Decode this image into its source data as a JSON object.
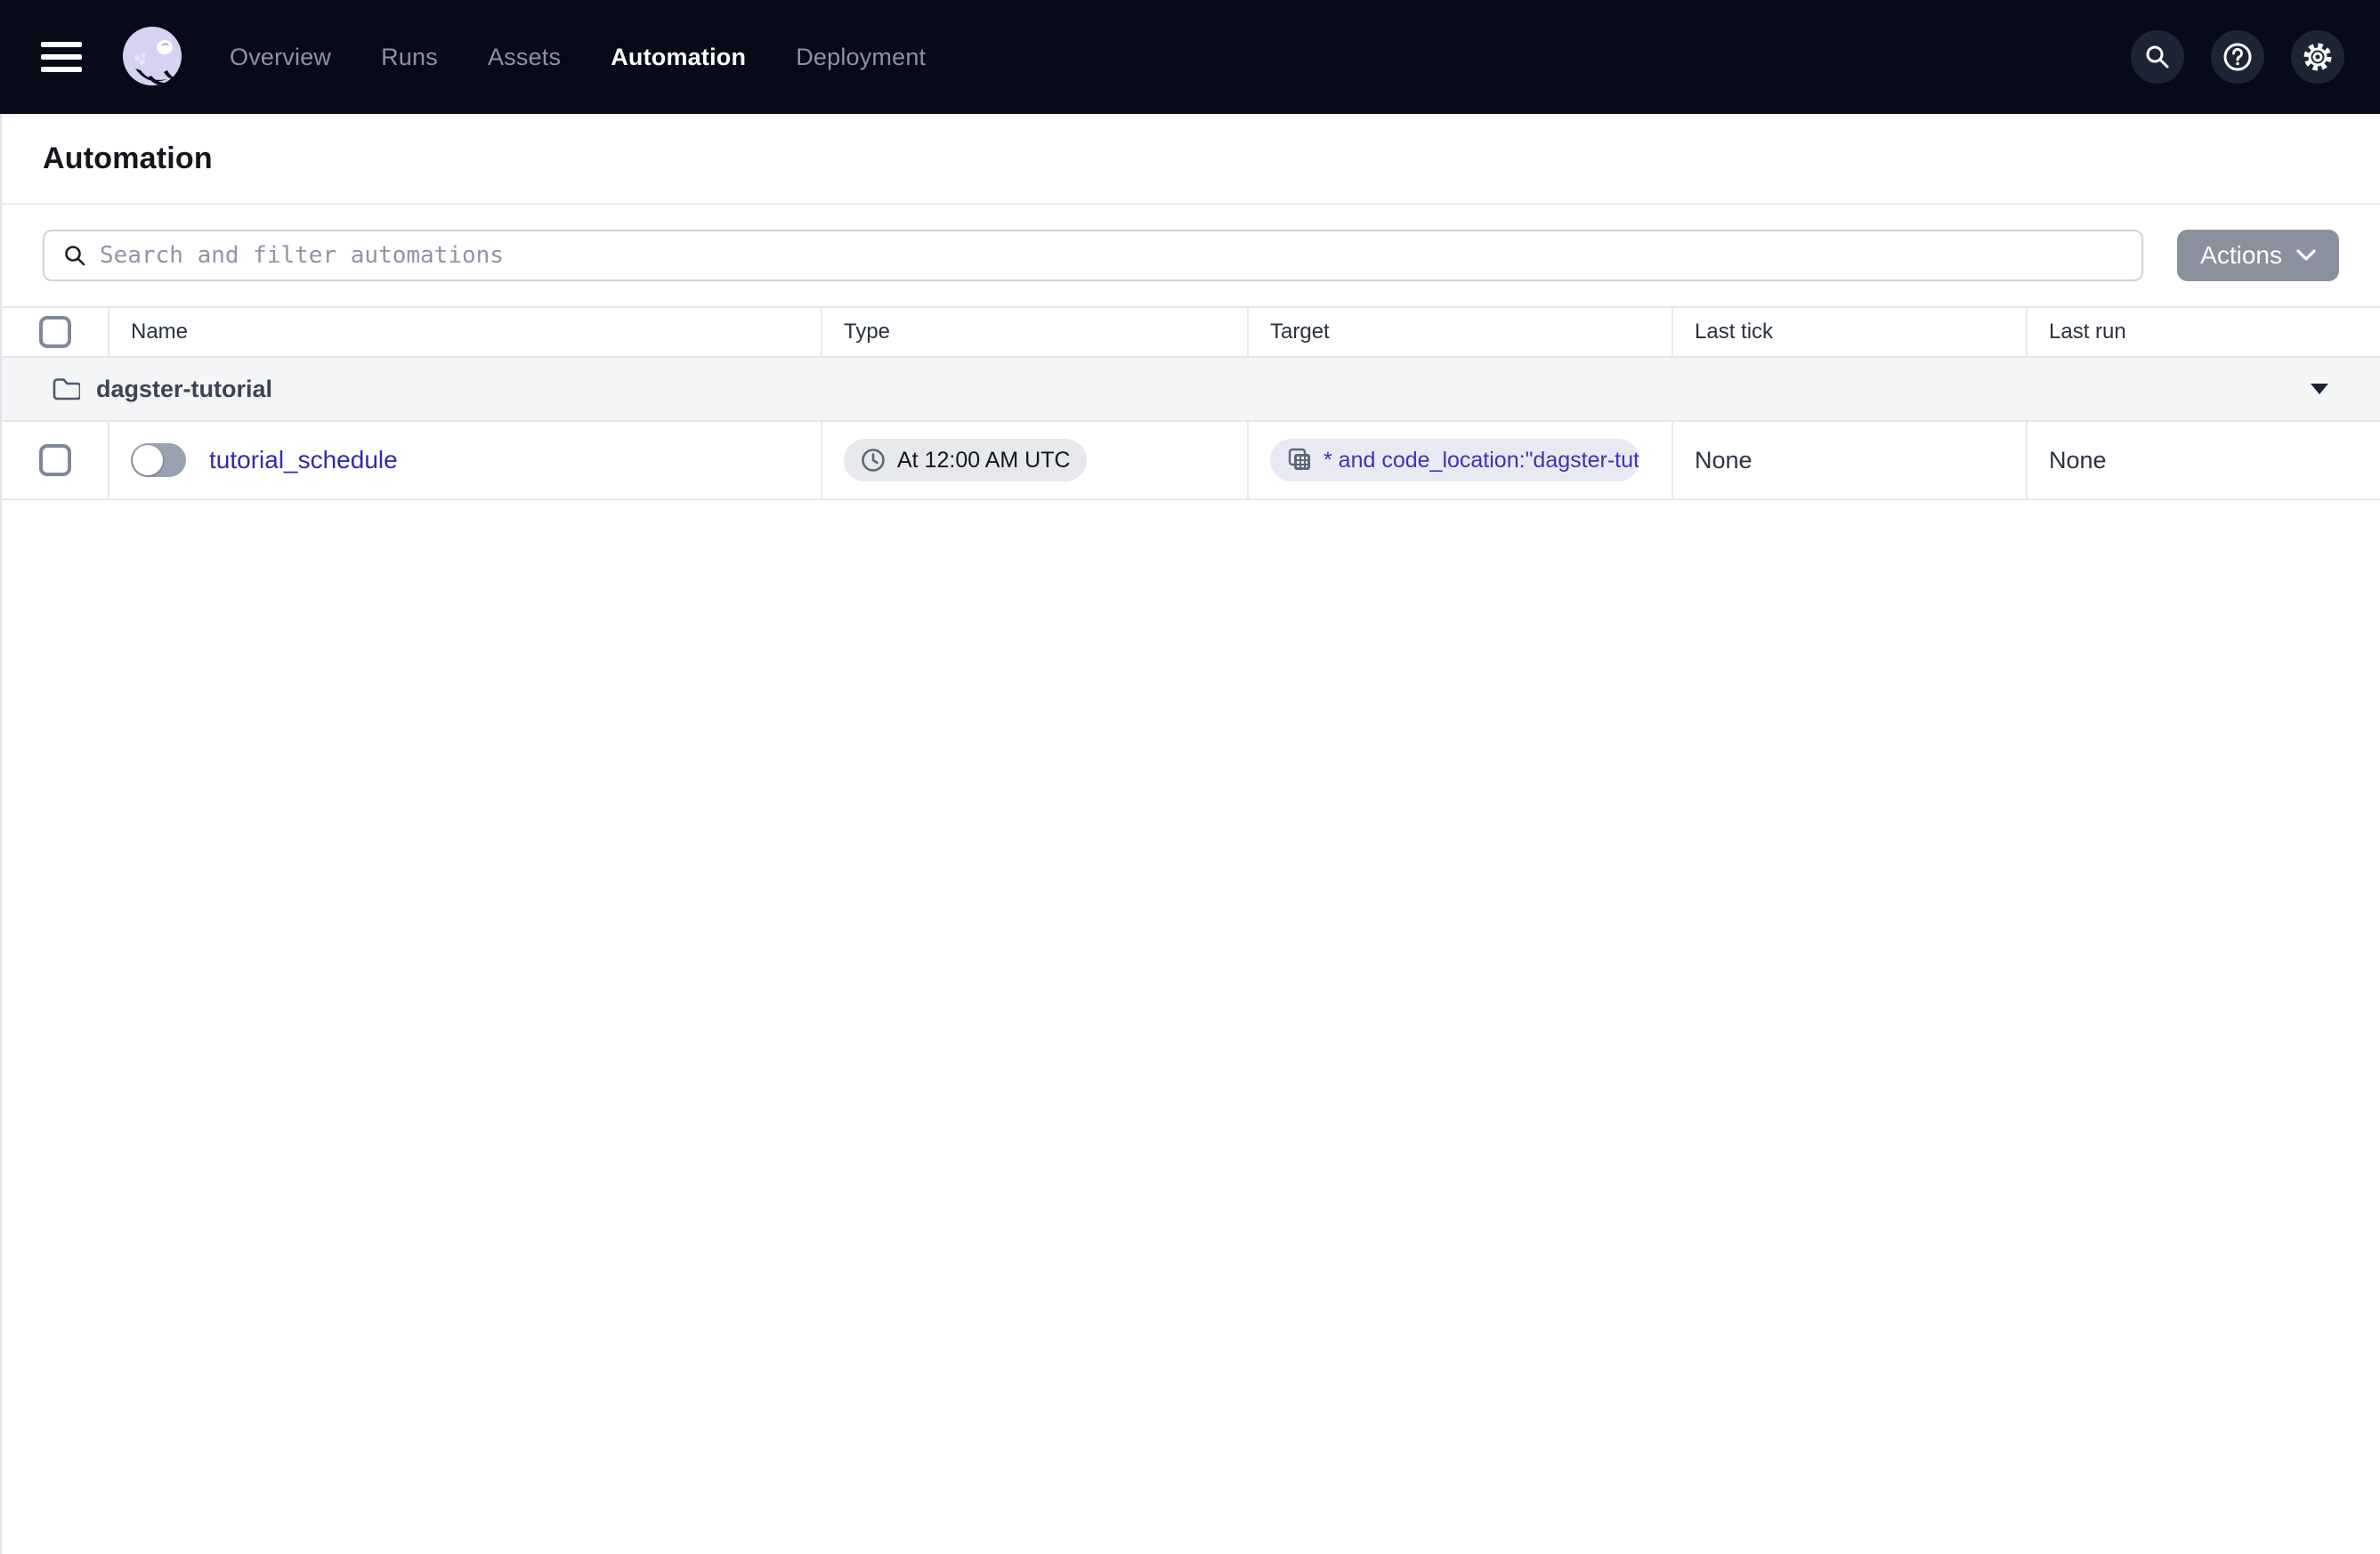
{
  "nav": {
    "items": [
      {
        "label": "Overview",
        "active": false
      },
      {
        "label": "Runs",
        "active": false
      },
      {
        "label": "Assets",
        "active": false
      },
      {
        "label": "Automation",
        "active": true
      },
      {
        "label": "Deployment",
        "active": false
      }
    ],
    "icon_buttons": [
      "search",
      "help",
      "settings"
    ]
  },
  "page": {
    "title": "Automation"
  },
  "toolbar": {
    "search_placeholder": "Search and filter automations",
    "actions_label": "Actions"
  },
  "table": {
    "columns": [
      "Name",
      "Type",
      "Target",
      "Last tick",
      "Last run"
    ],
    "groups": [
      {
        "name": "dagster-tutorial",
        "rows": [
          {
            "name": "tutorial_schedule",
            "enabled": false,
            "type": "At 12:00 AM UTC",
            "target": "* and code_location:\"dagster-tut",
            "last_tick": "None",
            "last_run": "None"
          }
        ]
      }
    ]
  },
  "colors": {
    "nav_bg": "#070a17",
    "nav_icon_circle": "#1d2433",
    "nav_inactive": "#8b93a3",
    "nav_active": "#ffffff",
    "logo_lavender": "#d5d2f2",
    "link": "#312ca8",
    "group_row_bg": "#f4f5f7",
    "pill_bg": "#e6e8ec",
    "target_pill_bg": "#e9e9f4",
    "actions_bg": "#8b919c",
    "border": "#e3e6ea"
  }
}
